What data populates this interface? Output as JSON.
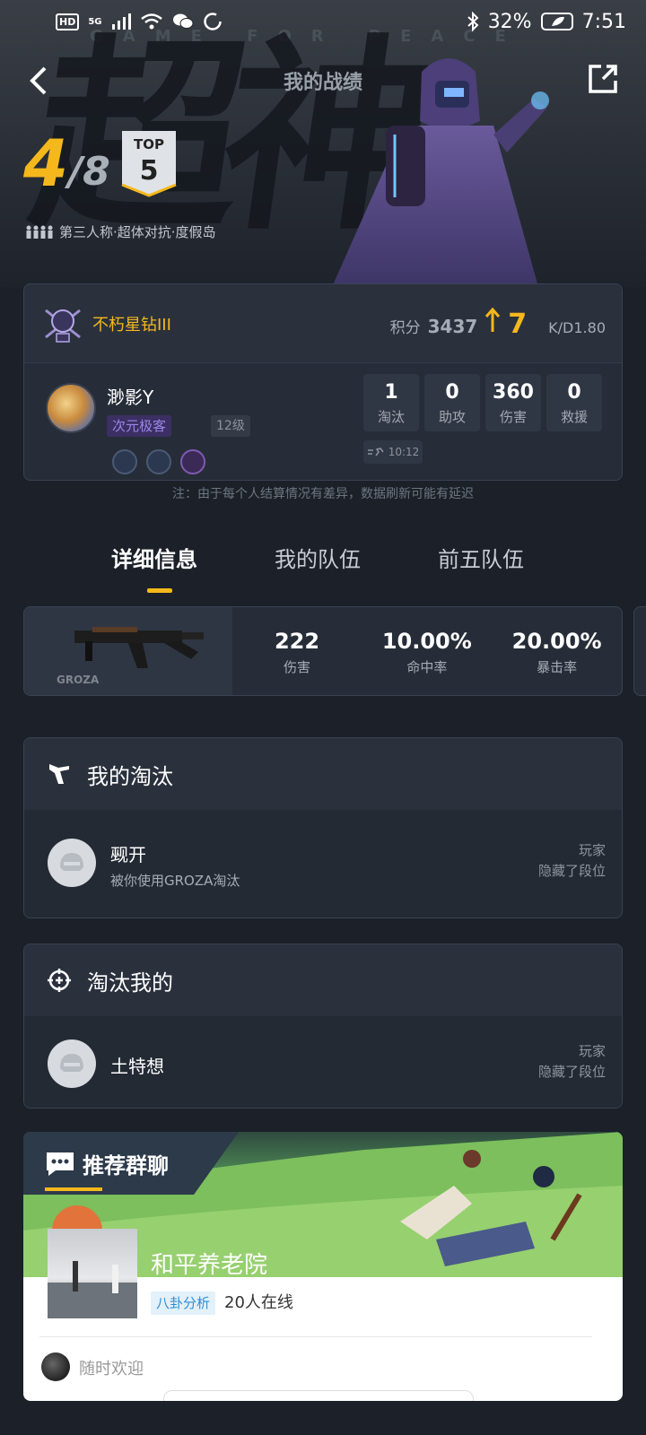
{
  "status_bar": {
    "hd": "HD",
    "net": "5G",
    "battery_pct": "32%",
    "time": "7:51"
  },
  "header": {
    "title": "我的战绩",
    "hero_text": "超神",
    "hero_tagline": "GAME FOR PEACE"
  },
  "rank": {
    "place": "4",
    "total": "/8",
    "top_label": "TOP",
    "top_value": "5",
    "mode": "第三人称·超体对抗·度假岛"
  },
  "stats_card": {
    "tier": "不朽星钻III",
    "score_label": "积分",
    "score": "3437",
    "score_delta": "7",
    "kd": "K/D1.80",
    "player_name": "渺影Y",
    "title_tag": "次元极客",
    "level_tag": "12级",
    "stats": [
      {
        "value": "1",
        "label": "淘汰"
      },
      {
        "value": "0",
        "label": "助攻"
      },
      {
        "value": "360",
        "label": "伤害"
      },
      {
        "value": "0",
        "label": "救援"
      }
    ],
    "time": "10:12"
  },
  "note": "注：由于每个人结算情况有差异，数据刷新可能有延迟",
  "tabs": [
    {
      "label": "详细信息",
      "active": true
    },
    {
      "label": "我的队伍",
      "active": false
    },
    {
      "label": "前五队伍",
      "active": false
    }
  ],
  "weapon": {
    "name": "GROZA",
    "stats": [
      {
        "value": "222",
        "label": "伤害"
      },
      {
        "value": "10.00%",
        "label": "命中率"
      },
      {
        "value": "20.00%",
        "label": "暴击率"
      }
    ]
  },
  "my_kills": {
    "title": "我的淘汰",
    "name": "觋开",
    "desc": "被你使用GROZA淘汰",
    "right_top": "玩家",
    "right_bottom": "隐藏了段位"
  },
  "killed_me": {
    "title": "淘汰我的",
    "name": "土特想",
    "right_top": "玩家",
    "right_bottom": "隐藏了段位"
  },
  "group_chat": {
    "title": "推荐群聊",
    "name": "和平养老院",
    "tag": "八卦分析",
    "online": "20人在线",
    "message": "随时欢迎"
  },
  "colors": {
    "accent": "#f5b81c",
    "card_bg": "#262d38",
    "page_bg": "#1b2029",
    "purple_tag": "#9b86e8"
  }
}
